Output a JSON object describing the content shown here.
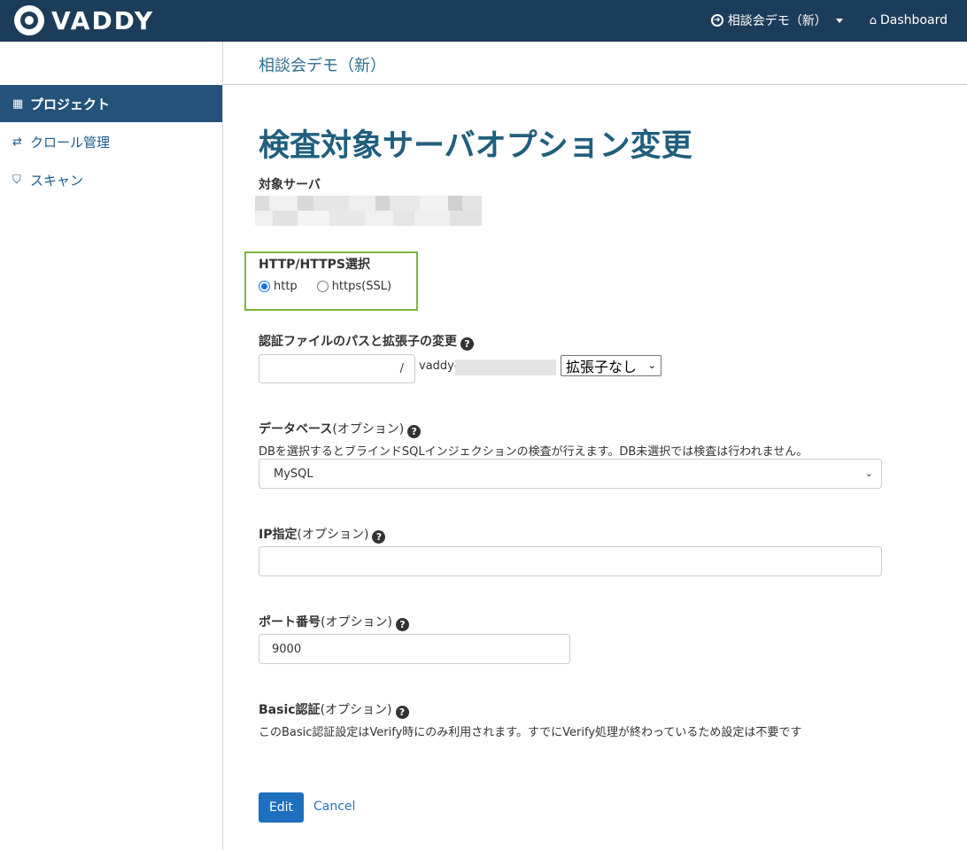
{
  "app": {
    "logo_text": "VADDY"
  },
  "topbar": {
    "project_label": "相談会デモ（新）",
    "dashboard_label": "Dashboard"
  },
  "sidebar": {
    "items": [
      {
        "label": "プロジェクト",
        "icon": "building-icon",
        "active": true
      },
      {
        "label": "クロール管理",
        "icon": "exchange-icon",
        "active": false
      },
      {
        "label": "スキャン",
        "icon": "shield-icon",
        "active": false
      }
    ]
  },
  "page": {
    "project_name": "相談会デモ（新）",
    "title": "検査対象サーバオプション変更"
  },
  "form": {
    "target_server": {
      "label": "対象サーバ"
    },
    "protocol": {
      "label": "HTTP/HTTPS選択",
      "options": [
        {
          "label": "http",
          "checked": true
        },
        {
          "label": "https(SSL)",
          "checked": false
        }
      ]
    },
    "auth_file": {
      "label": "認証ファイルのパスと拡張子の変更",
      "path_value": "",
      "slash": "/",
      "vaddy_prefix": "vaddy-",
      "extension_selected": "拡張子なし"
    },
    "database": {
      "label_main": "データベース",
      "label_opt": "(オプション)",
      "description": "DBを選択するとブラインドSQLインジェクションの検査が行えます。DB未選択では検査は行われません。",
      "selected": "MySQL"
    },
    "ip": {
      "label_main": "IP指定",
      "label_opt": "(オプション)",
      "value": ""
    },
    "port": {
      "label_main": "ポート番号",
      "label_opt": "(オプション)",
      "value": "9000"
    },
    "basic_auth": {
      "label_main": "Basic認証",
      "label_opt": "(オプション)",
      "description": "このBasic認証設定はVerify時にのみ利用されます。すでにVerify処理が終わっているため設定は不要です"
    },
    "edit_label": "Edit",
    "cancel_label": "Cancel"
  },
  "colors": {
    "header_bg": "#1c3d5a",
    "sidebar_active": "#24527a",
    "title": "#1f5f7d",
    "highlight_box": "#7fb538",
    "primary_button": "#1e6fbd"
  }
}
